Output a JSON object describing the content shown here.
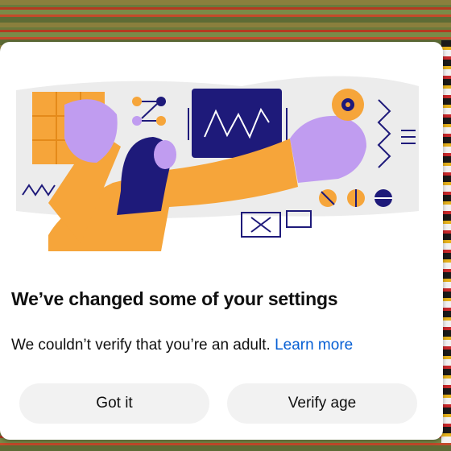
{
  "dialog": {
    "title": "We’ve changed some of your settings",
    "body": "We couldn’t verify that you’re an adult.",
    "learn_more": "Learn more",
    "buttons": {
      "got_it": "Got it",
      "verify_age": "Verify age"
    }
  },
  "colors": {
    "accent_orange": "#f6a53a",
    "purple": "#c09cf0",
    "navy": "#1e1a7a",
    "link_blue": "#065fd4",
    "button_bg": "#f2f2f2"
  },
  "illustration": {
    "semantic": "person-with-settings-illustration"
  }
}
